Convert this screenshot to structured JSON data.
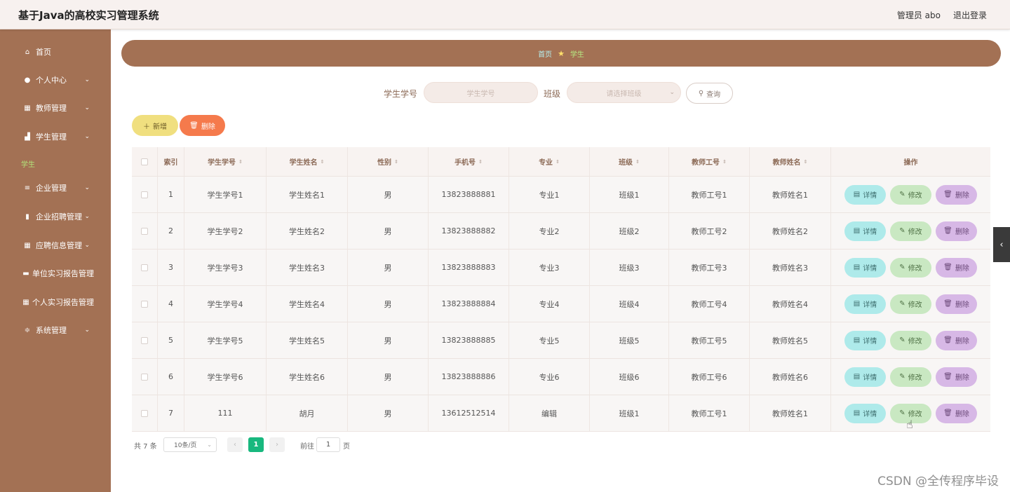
{
  "header": {
    "title": "基于Java的高校实习管理系统",
    "user": "管理员 abo",
    "logout": "退出登录"
  },
  "sidebar": {
    "items": [
      {
        "label": "首页",
        "icon": "⌂",
        "icon_name": "home-icon",
        "arrow": false
      },
      {
        "label": "个人中心",
        "icon": "●",
        "icon_name": "user-icon",
        "arrow": true
      },
      {
        "label": "教师管理",
        "icon": "▦",
        "icon_name": "grid-icon",
        "arrow": true
      },
      {
        "label": "学生管理",
        "icon": "▟",
        "icon_name": "school-icon",
        "arrow": true
      },
      {
        "label": "企业管理",
        "icon": "≡",
        "icon_name": "list-icon",
        "arrow": true
      },
      {
        "label": "企业招聘管理",
        "icon": "▮",
        "icon_name": "chart-icon",
        "arrow": true
      },
      {
        "label": "应聘信息管理",
        "icon": "▦",
        "icon_name": "grid-icon",
        "arrow": true
      },
      {
        "label": "单位实习报告管理",
        "icon": "▬",
        "icon_name": "building-icon",
        "arrow": false
      },
      {
        "label": "个人实习报告管理",
        "icon": "▦",
        "icon_name": "grid-icon",
        "arrow": false
      },
      {
        "label": "系统管理",
        "icon": "≑",
        "icon_name": "settings-icon",
        "arrow": true
      }
    ],
    "submenu_student": "学生"
  },
  "breadcrumb": {
    "home": "首页",
    "current": "学生"
  },
  "search": {
    "student_no_label": "学生学号",
    "student_no_placeholder": "学生学号",
    "class_label": "班级",
    "class_placeholder": "请选择班级",
    "query_button": "查询"
  },
  "actions": {
    "add": "新增",
    "delete": "删除"
  },
  "table": {
    "headers": [
      "索引",
      "学生学号",
      "学生姓名",
      "性别",
      "手机号",
      "专业",
      "班级",
      "教师工号",
      "教师姓名",
      "操作"
    ],
    "rows": [
      [
        "1",
        "学生学号1",
        "学生姓名1",
        "男",
        "13823888881",
        "专业1",
        "班级1",
        "教师工号1",
        "教师姓名1"
      ],
      [
        "2",
        "学生学号2",
        "学生姓名2",
        "男",
        "13823888882",
        "专业2",
        "班级2",
        "教师工号2",
        "教师姓名2"
      ],
      [
        "3",
        "学生学号3",
        "学生姓名3",
        "男",
        "13823888883",
        "专业3",
        "班级3",
        "教师工号3",
        "教师姓名3"
      ],
      [
        "4",
        "学生学号4",
        "学生姓名4",
        "男",
        "13823888884",
        "专业4",
        "班级4",
        "教师工号4",
        "教师姓名4"
      ],
      [
        "5",
        "学生学号5",
        "学生姓名5",
        "男",
        "13823888885",
        "专业5",
        "班级5",
        "教师工号5",
        "教师姓名5"
      ],
      [
        "6",
        "学生学号6",
        "学生姓名6",
        "男",
        "13823888886",
        "专业6",
        "班级6",
        "教师工号6",
        "教师姓名6"
      ],
      [
        "7",
        "111",
        "胡月",
        "男",
        "13612512514",
        "编辑",
        "班级1",
        "教师工号1",
        "教师姓名1"
      ]
    ],
    "row_actions": {
      "detail": "详情",
      "edit": "修改",
      "remove": "删除"
    }
  },
  "pagination": {
    "total": "共 7 条",
    "page_size": "10条/页",
    "current_page": "1",
    "goto_prefix": "前往",
    "goto_value": "1",
    "goto_suffix": "页"
  },
  "watermark": "CSDN @全传程序毕设",
  "colors": {
    "sidebar": "#a37154",
    "header": "#f7f1ef",
    "add_button": "#f0df7f",
    "delete_button": "#f57a4c",
    "detail_button": "#aeeaea",
    "edit_button": "#c9e8c2",
    "remove_button": "#d7b8e6",
    "pagination_active": "#18b87e"
  }
}
